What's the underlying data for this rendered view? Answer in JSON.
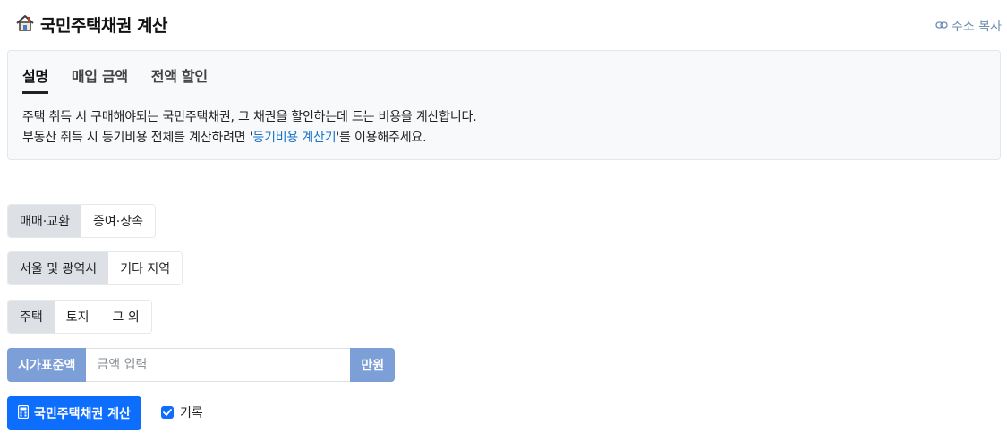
{
  "header": {
    "title": "국민주택채권 계산",
    "copy_link": "주소 복사"
  },
  "tabs": [
    {
      "label": "설명",
      "active": true
    },
    {
      "label": "매입 금액",
      "active": false
    },
    {
      "label": "전액 할인",
      "active": false
    }
  ],
  "description": {
    "line1": "주택 취득 시 구매해야되는 국민주택채권, 그 채권을 할인하는데 드는 비용을 계산합니다.",
    "line2_prefix": "부동산 취득 시 등기비용 전체를 계산하려면 '",
    "line2_link": "등기비용 계산기",
    "line2_suffix": "'를 이용해주세요."
  },
  "transaction_type": {
    "options": [
      "매매·교환",
      "증여·상속"
    ],
    "selected": "매매·교환"
  },
  "region": {
    "options": [
      "서울 및 광역시",
      "기타 지역"
    ],
    "selected": "서울 및 광역시"
  },
  "property_type": {
    "options": [
      "주택",
      "토지",
      "그 외"
    ],
    "selected": "주택"
  },
  "amount_input": {
    "prefix_label": "시가표준액",
    "placeholder": "금액 입력",
    "value": "",
    "unit": "만원"
  },
  "calculate_button": {
    "label": "국민주택채권 계산"
  },
  "record_checkbox": {
    "label": "기록",
    "checked": true
  },
  "colors": {
    "primary": "#0d6efd",
    "addon": "#7b9fd6",
    "link": "#1a73c8",
    "segment_active": "#dde1e6"
  }
}
